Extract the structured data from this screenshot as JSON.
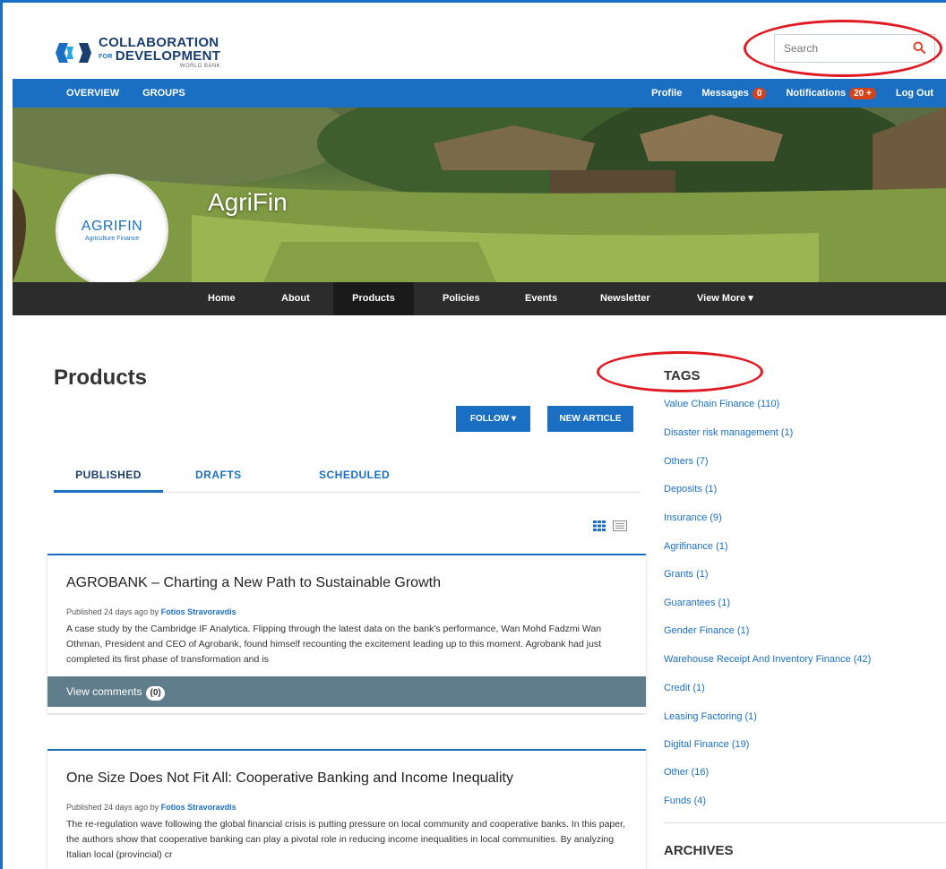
{
  "header": {
    "logo_line1": "COLLABORATION",
    "logo_for": "FOR",
    "logo_line2": "DEVELOPMENT",
    "logo_line3": "WORLD BANK",
    "search_placeholder": "Search",
    "search_icon": "search-icon"
  },
  "topnav": {
    "overview": "OVERVIEW",
    "groups": "GROUPS",
    "profile": "Profile",
    "messages": "Messages",
    "messages_count": "0",
    "notifications": "Notifications",
    "notifications_count": "20 +",
    "logout": "Log Out"
  },
  "banner": {
    "group_name": "AgriFin",
    "logo_name": "AGRIFIN",
    "logo_sub": "Agriculture Finance"
  },
  "subnav": {
    "items": [
      "Home",
      "About",
      "Products",
      "Policies",
      "Events",
      "Newsletter",
      "View More"
    ],
    "active": "Products"
  },
  "main": {
    "title": "Products",
    "follow_label": "FOLLOW",
    "new_article_label": "NEW ARTICLE",
    "tabs": [
      "PUBLISHED",
      "DRAFTS",
      "SCHEDULED"
    ],
    "active_tab": "PUBLISHED"
  },
  "articles": [
    {
      "title": "AGROBANK – Charting a New Path to Sustainable Growth",
      "meta_prefix": "Published 24 days ago by",
      "author": "Fotios Stravoravdis",
      "excerpt": "A case study by the Cambridge IF Analytica. Flipping through the latest data on the bank's performance, Wan Mohd Fadzmi Wan Othman, President and CEO of Agrobank, found himself recounting the excitement leading up to this moment. Agrobank had just completed its first phase of transformation and is",
      "comments_label": "View comments",
      "comments_count": "(0)"
    },
    {
      "title": "One Size Does Not Fit All: Cooperative Banking and Income Inequality",
      "meta_prefix": "Published 24 days ago by",
      "author": "Fotios Stravoravdis",
      "excerpt": "The re-regulation wave following the global financial crisis is putting pressure on local community and cooperative banks. In this paper, the authors show that cooperative banking can play a pivotal role in reducing income inequalities in local communities. By analyzing Italian local (provincial) cr"
    }
  ],
  "sidebar": {
    "tags_heading": "TAGS",
    "tags": [
      "Value Chain Finance (110)",
      "Disaster risk management (1)",
      "Others (7)",
      "Deposits (1)",
      "Insurance (9)",
      "Agrifinance (1)",
      "Grants (1)",
      "Guarantees (1)",
      "Gender Finance (1)",
      "Warehouse Receipt And Inventory Finance (42)",
      "Credit (1)",
      "Leasing Factoring (1)",
      "Digital Finance (19)",
      "Other (16)",
      "Funds (4)"
    ],
    "archives_heading": "ARCHIVES"
  },
  "colors": {
    "accent": "#1b6fc2",
    "highlight_annotation": "#e01a22",
    "badge": "#d4441c",
    "comments_bar": "#607d8b"
  }
}
